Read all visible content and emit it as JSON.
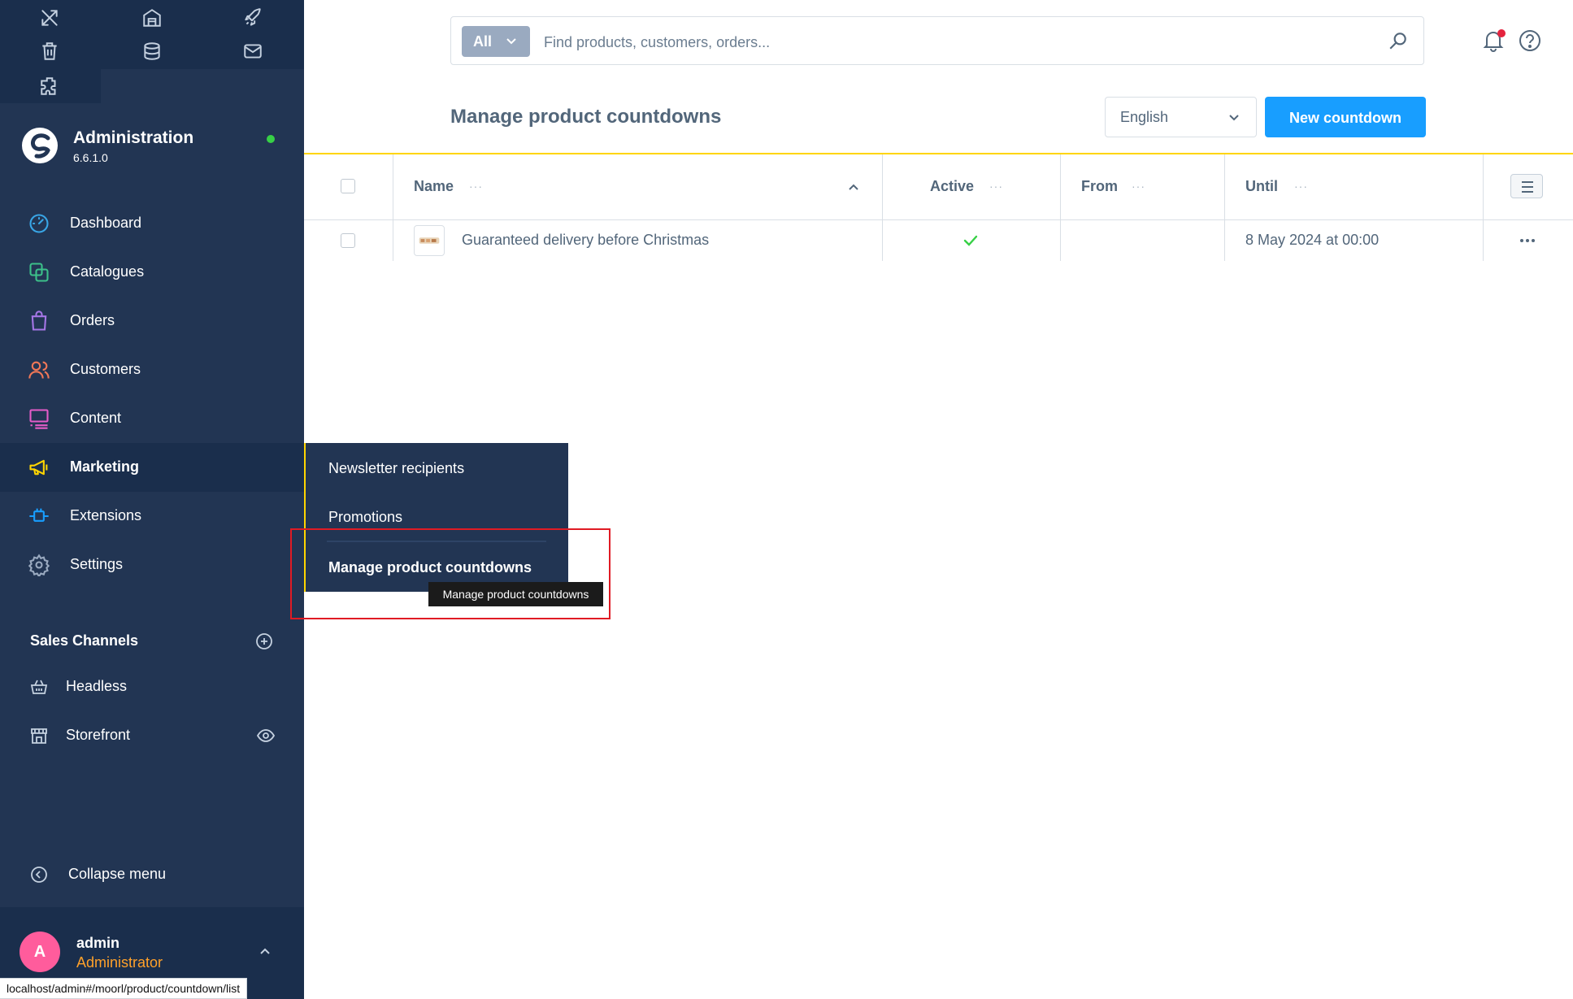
{
  "colors": {
    "sidebar_bg": "#223553",
    "sidebar_dark": "#1a2e4c",
    "primary": "#189eff",
    "accent_yellow": "#ffd500",
    "online_green": "#37d046",
    "avatar_pink": "#ff5c9c",
    "role_orange": "#ffa12a",
    "highlight_red": "#e01b24"
  },
  "sidebar": {
    "quick_icons": [
      "tools-icon",
      "warehouse-icon",
      "rocket-icon",
      "trash-icon",
      "database-icon",
      "mail-icon",
      "puzzle-icon"
    ],
    "brand": {
      "title": "Administration",
      "version": "6.6.1.0"
    },
    "nav": [
      {
        "label": "Dashboard",
        "icon": "gauge-icon"
      },
      {
        "label": "Catalogues",
        "icon": "catalogue-icon"
      },
      {
        "label": "Orders",
        "icon": "shopping-bag-icon"
      },
      {
        "label": "Customers",
        "icon": "users-icon"
      },
      {
        "label": "Content",
        "icon": "content-icon"
      },
      {
        "label": "Marketing",
        "icon": "megaphone-icon",
        "active": true
      },
      {
        "label": "Extensions",
        "icon": "plug-icon"
      },
      {
        "label": "Settings",
        "icon": "gear-icon"
      }
    ],
    "sales_channels_title": "Sales Channels",
    "channels": [
      {
        "label": "Headless",
        "icon": "basket-icon"
      },
      {
        "label": "Storefront",
        "icon": "storefront-icon"
      }
    ],
    "collapse_label": "Collapse menu",
    "user": {
      "initial": "A",
      "name": "admin",
      "role": "Administrator"
    }
  },
  "status_url": "localhost/admin#/moorl/product/countdown/list",
  "search": {
    "type_label": "All",
    "placeholder": "Find products, customers, orders..."
  },
  "page": {
    "title": "Manage product countdowns",
    "language": "English",
    "new_button": "New countdown"
  },
  "table": {
    "columns": {
      "name": "Name",
      "active": "Active",
      "from": "From",
      "until": "Until"
    },
    "rows": [
      {
        "name": "Guaranteed delivery before Christmas",
        "active": true,
        "from": "",
        "until": "8 May 2024 at 00:00"
      }
    ]
  },
  "flyout": {
    "items": [
      "Newsletter recipients",
      "Promotions",
      "Manage product countdowns"
    ],
    "tooltip": "Manage product countdowns"
  }
}
